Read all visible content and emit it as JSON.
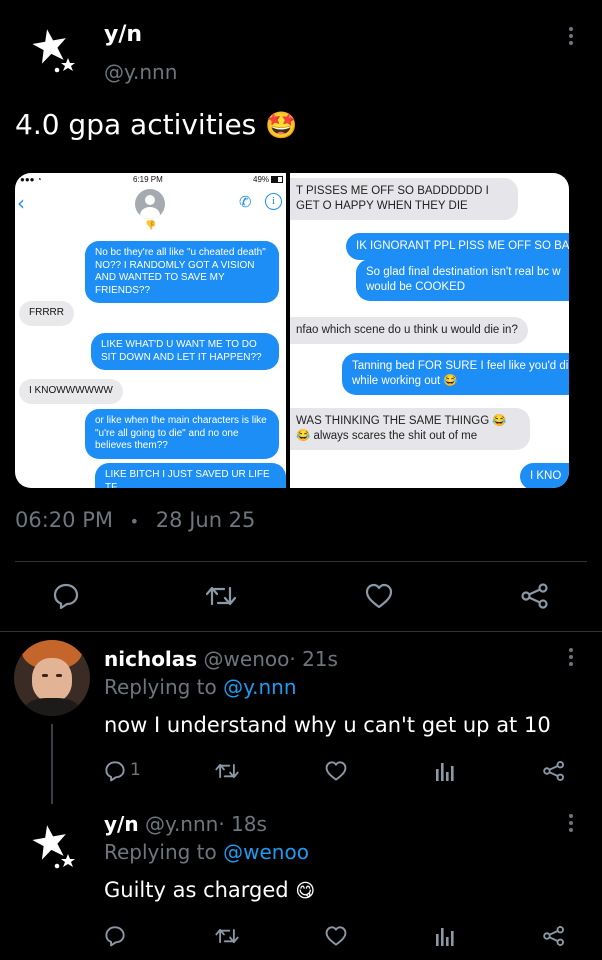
{
  "tweet": {
    "display_name": "y/n",
    "handle": "@y.nnn",
    "text": "4.0 gpa activities",
    "emoji_text": "🤩",
    "time": "06:20 PM",
    "separator": "•",
    "date": "28 Jun 25"
  },
  "screenshot_left": {
    "status_time": "6:19 PM",
    "battery": "49%",
    "messages": [
      "No bc they're all like \"u cheated death\" NO?? I RANDOMLY GOT A VISION AND WANTED TO SAVE MY FRIENDS??",
      "FRRRR",
      "LIKE WHAT'D U WANT ME TO DO SIT DOWN AND LET IT HAPPEN??",
      "I KNOWWWWWW",
      "or like when the main characters is like \"u're all going to die\" and no one believes them??",
      "LIKE BITCH I JUST SAVED UR LIFE TF"
    ]
  },
  "screenshot_right": {
    "messages": [
      "T PISSES ME OFF SO BADDDDDD I GET O HAPPY WHEN THEY DIE",
      "IK IGNORANT PPL PISS ME OFF SO BA",
      "So glad final destination isn't real bc w would be COOKED",
      "nfao which scene do u think u would die in?",
      "Tanning bed FOR SURE I feel like you'd di while working out 😂",
      "WAS THINKING THE SAME THINGG 😂😂 always scares the shit out of me",
      "I KNO"
    ]
  },
  "actions": [
    "reply-icon",
    "retweet-icon",
    "like-icon",
    "share-icon"
  ],
  "replies": [
    {
      "name": "nicholas",
      "handle": "@wenoo",
      "sep": "·",
      "age": "21s",
      "replying_prefix": "Replying to",
      "replying_to": "@y.nnn",
      "text": "now I understand why u can't get up at 10",
      "reply_count": "1"
    },
    {
      "name": "y/n",
      "handle": "@y.nnn",
      "sep": "·",
      "age": "18s",
      "replying_prefix": "Replying to",
      "replying_to": "@wenoo",
      "text": "Guilty as charged",
      "emoji_text": "😋",
      "reply_count": ""
    }
  ],
  "colors": {
    "background": "#000000",
    "muted": "#6e767d",
    "link": "#1d9bf0",
    "imessage_blue": "#1e8ef7"
  }
}
